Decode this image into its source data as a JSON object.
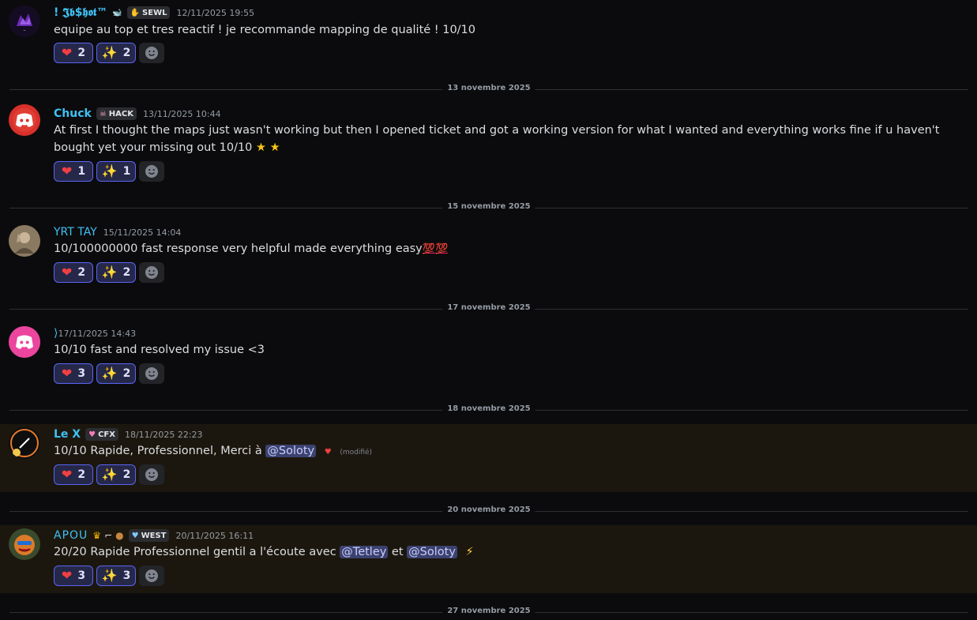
{
  "messages": [
    {
      "username": "! 𝕵𝖇$𝖍𝖔𝖙™",
      "extra_icon": "🐋",
      "tag": {
        "icon": "purple-hand-icon",
        "label": "SEWL"
      },
      "timestamp": "12/11/2025 19:55",
      "text": "equipe au top et tres reactif !  je recommande  mapping de qualité ! 10/10",
      "reactions": [
        {
          "emoji": "heart",
          "count": "2"
        },
        {
          "emoji": "sparkles",
          "count": "2"
        }
      ]
    },
    {
      "date_divider": "13 novembre 2025",
      "username": "Chuck",
      "tag": {
        "icon": "skull-icon",
        "label": "HACK"
      },
      "timestamp": "13/11/2025 10:44",
      "text": "At first I thought the maps just wasn't working but then I opened ticket and got a working version for what I wanted and everything works fine if u haven't bought yet your missing out 10/10",
      "reactions": [
        {
          "emoji": "heart",
          "count": "1"
        },
        {
          "emoji": "sparkles",
          "count": "1"
        }
      ]
    },
    {
      "date_divider": "15 novembre 2025",
      "username": "YRT TAY",
      "timestamp": "15/11/2025 14:04",
      "text": "10/100000000 fast response very helpful made everything easy",
      "reactions": [
        {
          "emoji": "heart",
          "count": "2"
        },
        {
          "emoji": "sparkles",
          "count": "2"
        }
      ]
    },
    {
      "date_divider": "17 novembre 2025",
      "username": "",
      "timestamp": "17/11/2025 14:43",
      "text": "10/10 fast and resolved my issue <3",
      "reactions": [
        {
          "emoji": "heart",
          "count": "3"
        },
        {
          "emoji": "sparkles",
          "count": "2"
        }
      ]
    },
    {
      "date_divider": "18 novembre 2025",
      "username": "Le X",
      "tag": {
        "icon": "pink-heart-icon",
        "label": "CFX"
      },
      "timestamp": "18/11/2025 22:23",
      "text_before": "10/10 Rapide, Professionnel, Merci à ",
      "mention": "@Soloty",
      "edited": "(modifié)",
      "reactions": [
        {
          "emoji": "heart",
          "count": "2"
        },
        {
          "emoji": "sparkles",
          "count": "2"
        }
      ]
    },
    {
      "date_divider": "20 novembre 2025",
      "username": "APOU",
      "tag": {
        "icon": "blue-heart-icon",
        "label": "WEST"
      },
      "timestamp": "20/11/2025 16:11",
      "text_before": "20/20 Rapide Professionnel gentil a l'écoute avec ",
      "mention1": "@Tetley",
      "text_mid": " et ",
      "mention2": "@Soloty",
      "reactions": [
        {
          "emoji": "heart",
          "count": "3"
        },
        {
          "emoji": "sparkles",
          "count": "3"
        }
      ]
    }
  ],
  "last_divider": "27 novembre 2025",
  "colors": {
    "background": "#0b0b0d",
    "highlight": "#1c170e",
    "username_blue": "#3ec1f3",
    "reaction_border": "#5865f2",
    "mention_bg": "#3c4270"
  },
  "icons": [
    "heart-icon",
    "sparkles-icon",
    "add-reaction-icon",
    "discord-logo-icon",
    "star-icon",
    "lightning-icon"
  ]
}
